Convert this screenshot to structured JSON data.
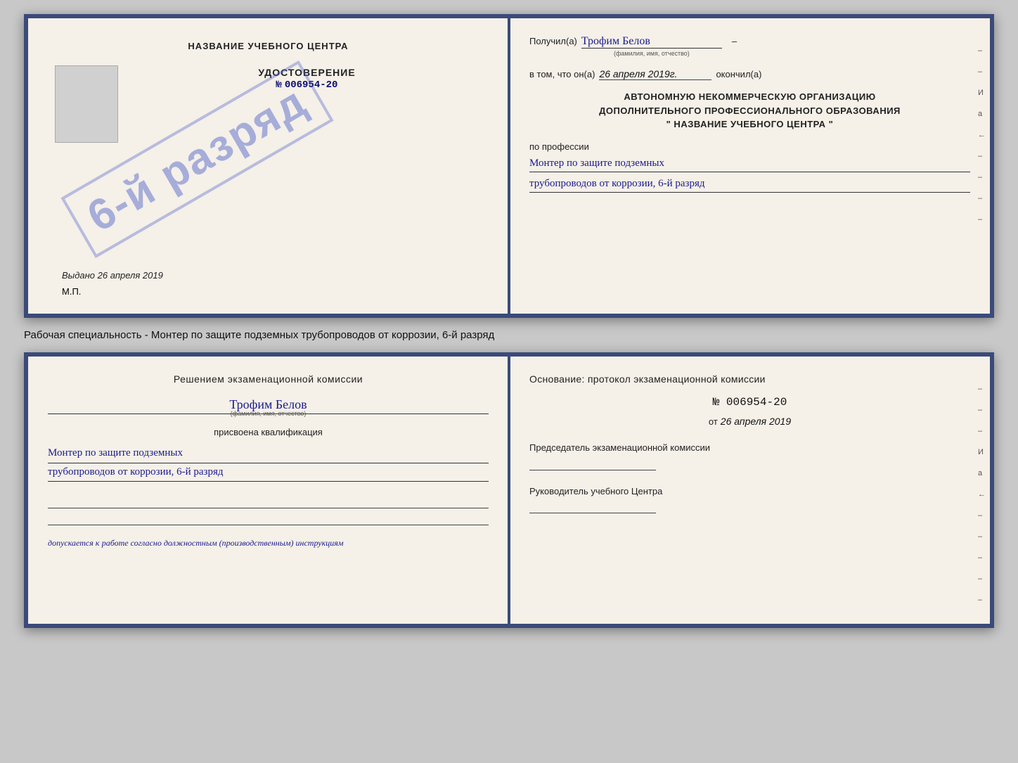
{
  "top_cert": {
    "left": {
      "title": "НАЗВАНИЕ УЧЕБНОГО ЦЕНТРА",
      "stamp_text": "6-й разряд",
      "udost_label": "УДОСТОВЕРЕНИЕ",
      "number_prefix": "№",
      "number": "006954-20",
      "vydano_label": "Выдано",
      "vydano_date": "26 апреля 2019",
      "mp_label": "М.П."
    },
    "right": {
      "poluchil_label": "Получил(а)",
      "poluchil_name": "Трофим Белов",
      "poluchil_sub": "(фамилия, имя, отчество)",
      "dash1": "–",
      "vtom_label": "в том, что он(а)",
      "vtom_date": "26 апреля 2019г.",
      "okochil_label": "окончил(а)",
      "org_line1": "АВТОНОМНУЮ НЕКОММЕРЧЕСКУЮ ОРГАНИЗАЦИЮ",
      "org_line2": "ДОПОЛНИТЕЛЬНОГО ПРОФЕССИОНАЛЬНОГО ОБРАЗОВАНИЯ",
      "org_line3": "\"  НАЗВАНИЕ УЧЕБНОГО ЦЕНТРА  \"",
      "dash_i": "И",
      "dash_a": "а",
      "dash_left": "←",
      "po_prof_label": "по профессии",
      "profession_line1": "Монтер по защите подземных",
      "profession_line2": "трубопроводов от коррозии, 6-й разряд",
      "dash_bot1": "–",
      "dash_bot2": "–",
      "dash_bot3": "–",
      "dash_bot4": "–"
    }
  },
  "specialty_label": "Рабочая специальность - Монтер по защите подземных трубопроводов от коррозии, 6-й разряд",
  "bottom_cert": {
    "left": {
      "title": "Решением экзаменационной комиссии",
      "name": "Трофим Белов",
      "name_sub": "(фамилия, имя, отчество)",
      "prisvoena_label": "присвоена квалификация",
      "qual_line1": "Монтер по защите подземных",
      "qual_line2": "трубопроводов от коррозии, 6-й разряд",
      "dopuskaetsya_label": "допускается к",
      "dopuskaetsya_value": "работе согласно должностным (производственным) инструкциям"
    },
    "right": {
      "osnov_label": "Основание: протокол экзаменационной комиссии",
      "number": "№ 006954-20",
      "date_prefix": "от",
      "date": "26 апреля 2019",
      "predsedatel_label": "Председатель экзаменационной комиссии",
      "ruk_label": "Руководитель учебного Центра",
      "dash_i": "И",
      "dash_a": "а",
      "dash_left": "←"
    }
  }
}
